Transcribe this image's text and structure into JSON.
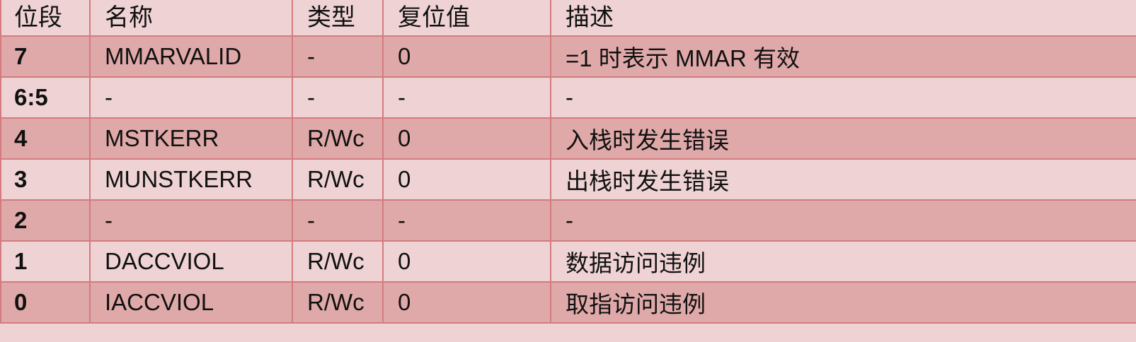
{
  "table": {
    "headers": [
      "位段",
      "名称",
      "类型",
      "复位值",
      "描述"
    ],
    "rows": [
      {
        "bit": "7",
        "name": "MMARVALID",
        "type": "-",
        "reset": "0",
        "desc": "=1 时表示 MMAR 有效"
      },
      {
        "bit": "6:5",
        "name": "-",
        "type": "-",
        "reset": "-",
        "desc": "-"
      },
      {
        "bit": "4",
        "name": "MSTKERR",
        "type": "R/Wc",
        "reset": "0",
        "desc": "入栈时发生错误"
      },
      {
        "bit": "3",
        "name": "MUNSTKERR",
        "type": "R/Wc",
        "reset": "0",
        "desc": "出栈时发生错误"
      },
      {
        "bit": "2",
        "name": "-",
        "type": "-",
        "reset": "-",
        "desc": "-"
      },
      {
        "bit": "1",
        "name": "DACCVIOL",
        "type": "R/Wc",
        "reset": "0",
        "desc": "数据访问违例"
      },
      {
        "bit": "0",
        "name": "IACCVIOL",
        "type": "R/Wc",
        "reset": "0",
        "desc": "取指访问违例"
      }
    ]
  },
  "colors": {
    "border": "#d37b7e",
    "row_dark": "#e0a9a9",
    "row_light": "#efd3d4"
  }
}
